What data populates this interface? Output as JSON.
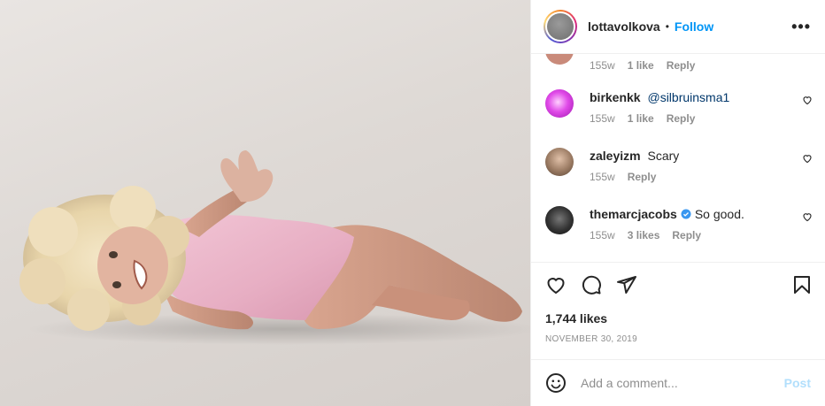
{
  "header": {
    "username": "lottavolkova",
    "separator": "•",
    "follow_label": "Follow",
    "more_label": "•••"
  },
  "comments": [
    {
      "username": "",
      "text": "",
      "time": "155w",
      "likes": "1 like",
      "reply_label": "Reply",
      "avatar_color": "#c98a7a",
      "partial": true
    },
    {
      "username": "birkenkk",
      "mention": "@silbruinsma1",
      "time": "155w",
      "likes": "1 like",
      "reply_label": "Reply",
      "avatar_color": "#d13ad8"
    },
    {
      "username": "zaleyizm",
      "text": "Scary",
      "time": "155w",
      "reply_label": "Reply",
      "avatar_color": "#8a6a55"
    },
    {
      "username": "themarcjacobs",
      "text": "So good.",
      "verified": true,
      "time": "155w",
      "likes": "3 likes",
      "reply_label": "Reply",
      "avatar_color": "#2a2a2a"
    }
  ],
  "post": {
    "likes": "1,744 likes",
    "date": "NOVEMBER 30, 2019"
  },
  "add_comment": {
    "placeholder": "Add a comment...",
    "post_label": "Post"
  },
  "colors": {
    "link_blue": "#0095f6",
    "muted": "#8e8e8e",
    "post_disabled": "#b2dffc",
    "verified_blue": "#3897f0"
  },
  "icons": [
    "heart-icon",
    "comment-icon",
    "share-icon",
    "bookmark-icon",
    "emoji-icon",
    "more-icon",
    "verified-icon"
  ]
}
